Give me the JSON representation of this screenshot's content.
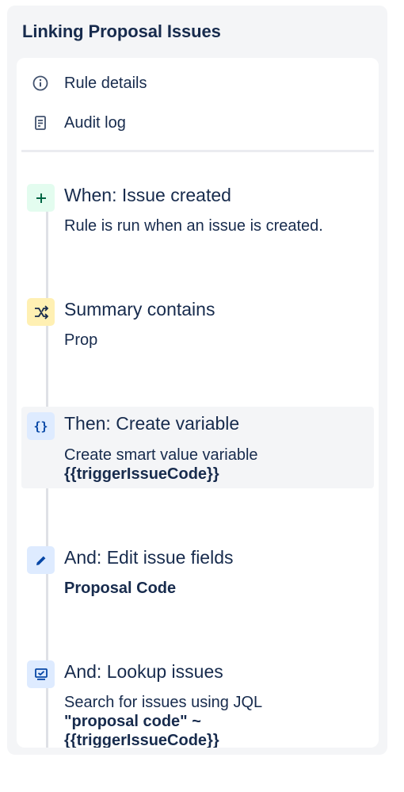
{
  "panel": {
    "title": "Linking Proposal Issues"
  },
  "menu": {
    "items": [
      {
        "label": "Rule details",
        "icon": "info-icon"
      },
      {
        "label": "Audit log",
        "icon": "document-icon"
      }
    ]
  },
  "steps": [
    {
      "title": "When: Issue created",
      "desc": "Rule is run when an issue is created.",
      "icon": "plus-icon",
      "color": "#e3fcef"
    },
    {
      "title": "Summary contains",
      "desc": "Prop",
      "icon": "shuffle-icon",
      "color": "#fff0b3"
    },
    {
      "title": "Then: Create variable",
      "desc": "Create smart value variable",
      "desc_bold": "{{triggerIssueCode}}",
      "icon": "braces-icon",
      "icon_text": "{}",
      "color": "#deebff"
    },
    {
      "title": "And: Edit issue fields",
      "desc_bold": "Proposal Code",
      "icon": "pencil-icon",
      "color": "#deebff"
    },
    {
      "title": "And: Lookup issues",
      "desc": "Search for issues using JQL",
      "desc_bold_line1": "\"proposal code\" ~",
      "desc_bold_line2": "{{triggerIssueCode}}",
      "icon": "lookup-icon",
      "color": "#deebff"
    }
  ]
}
